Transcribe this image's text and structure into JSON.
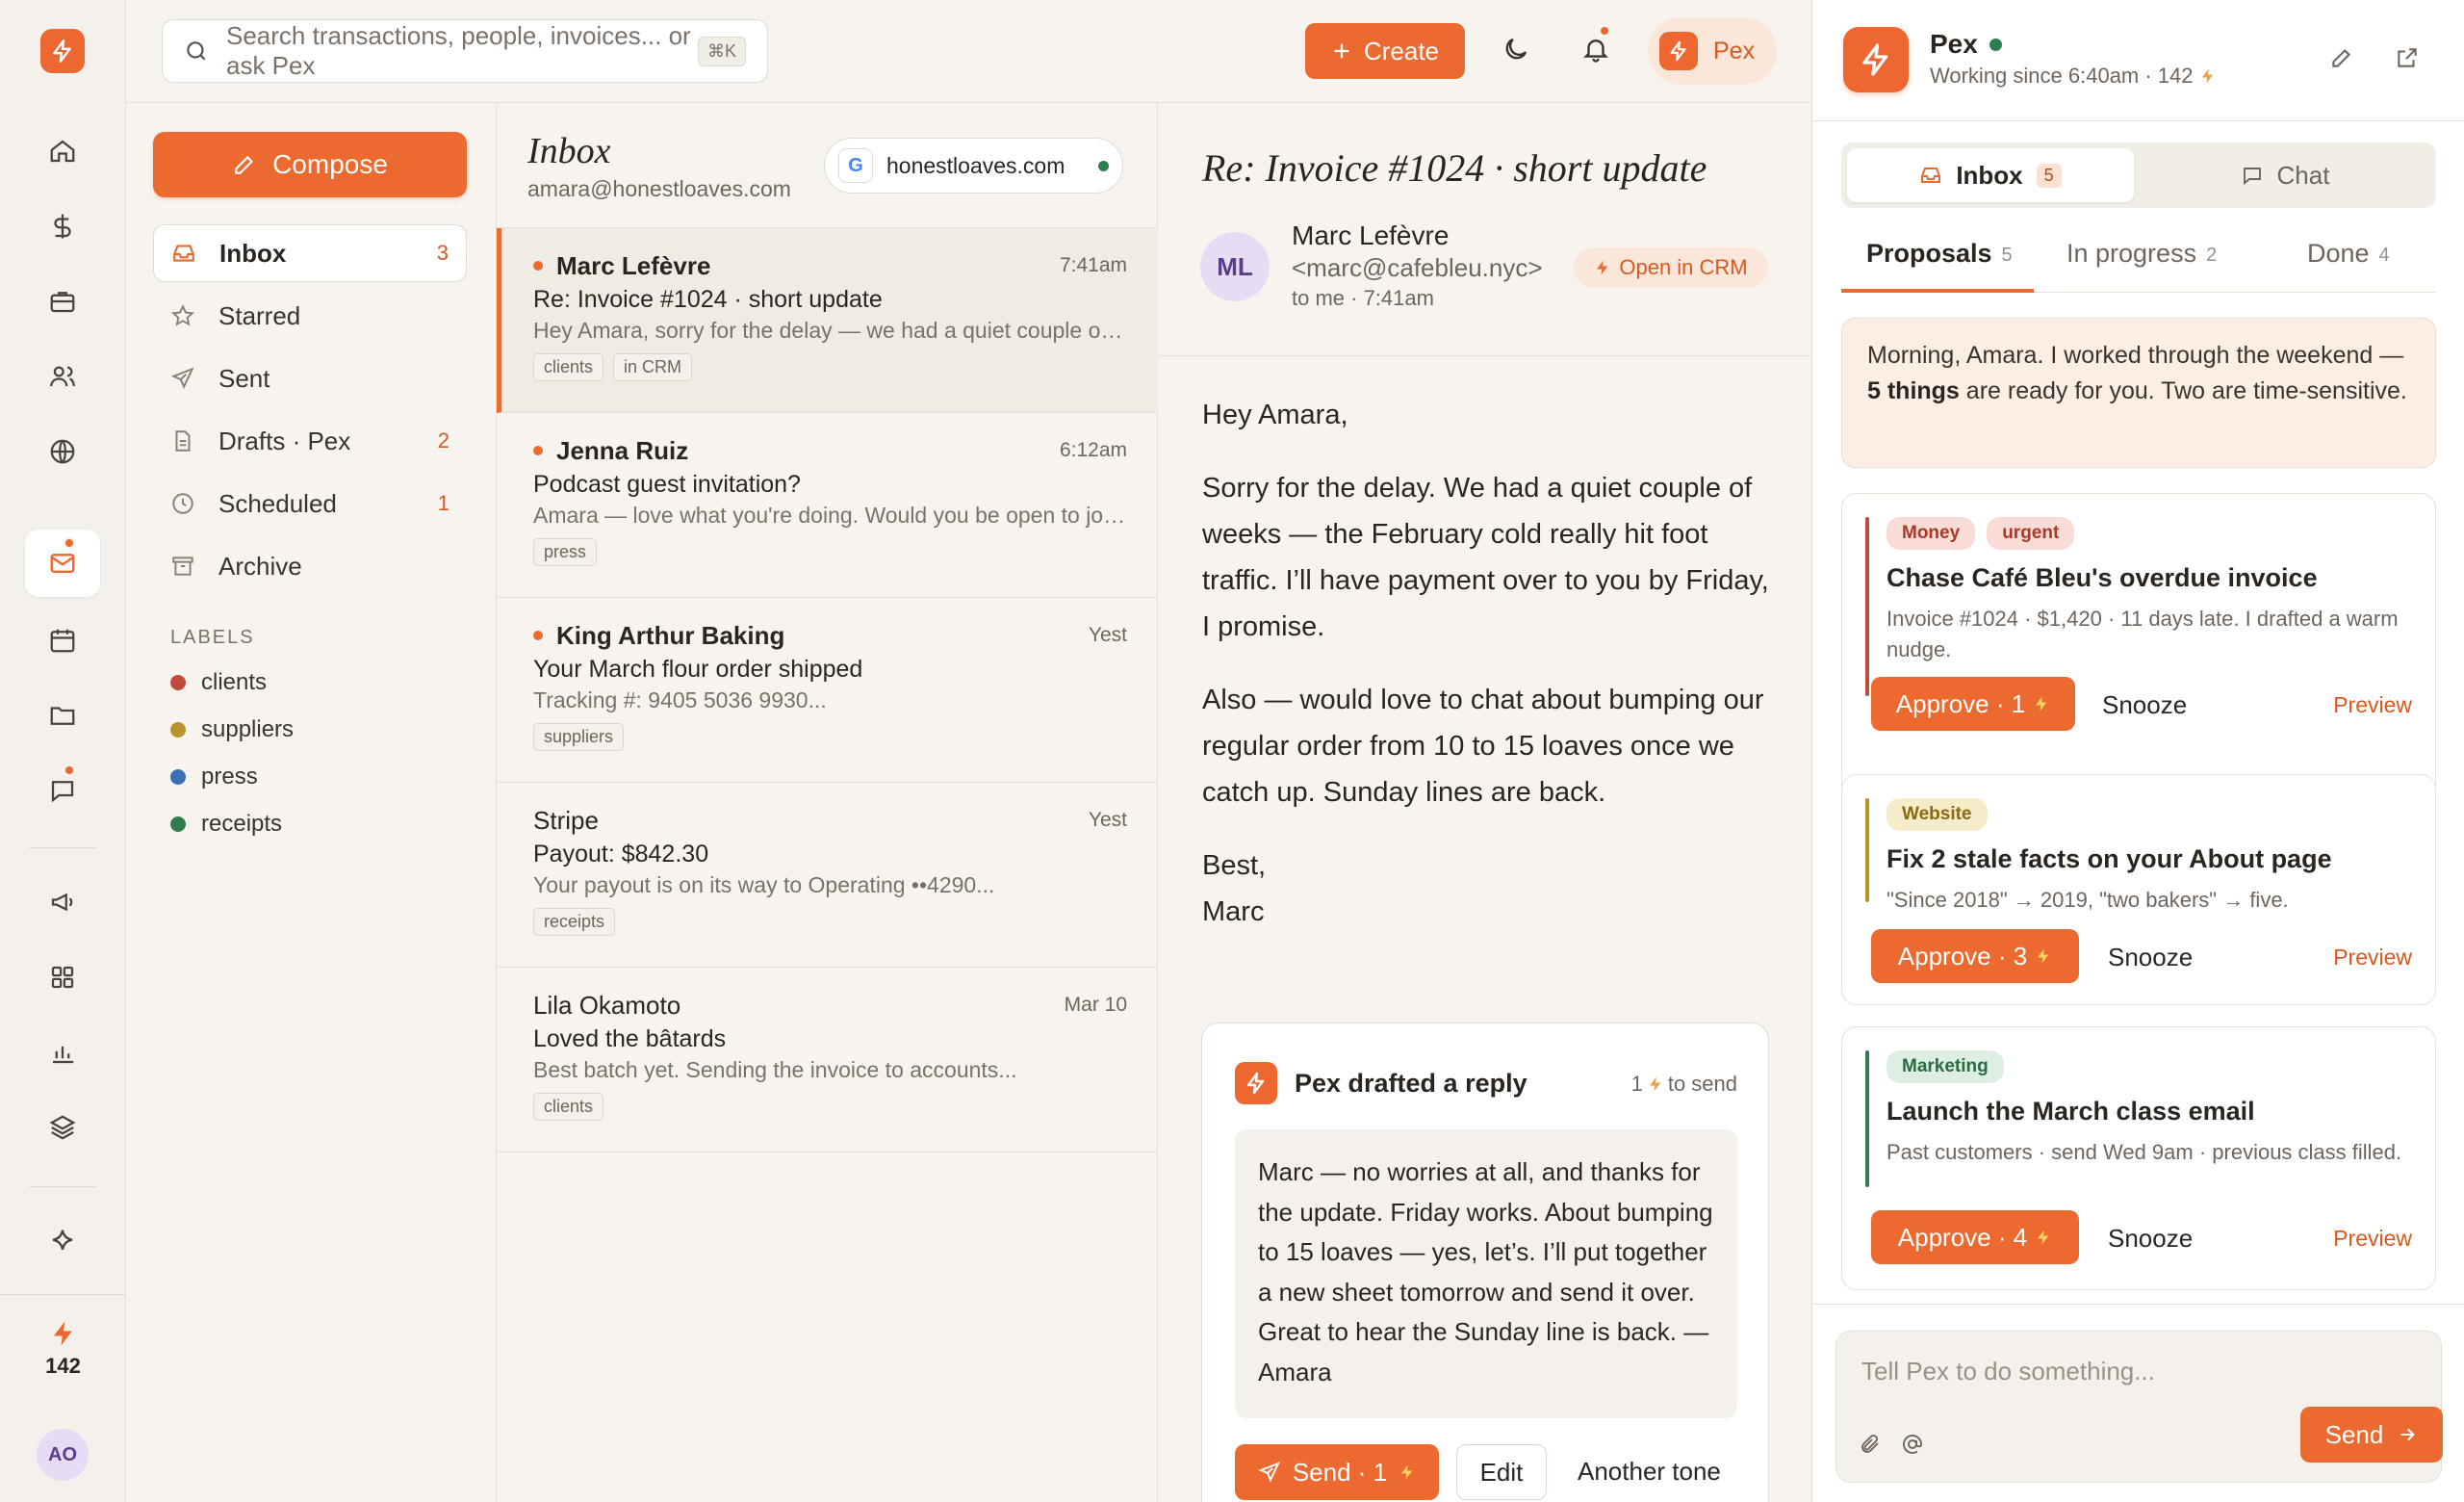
{
  "colors": {
    "accent": "#ec6a2f",
    "online": "#2e7d4f"
  },
  "rail": {
    "credits": "142",
    "avatar_initials": "AO",
    "icons": [
      "home-icon",
      "dollar-icon",
      "briefcase-icon",
      "people-icon",
      "globe-icon",
      "mail-icon",
      "calendar-icon",
      "folder-icon",
      "chat-icon",
      "megaphone-icon",
      "grid-icon",
      "chart-icon",
      "layers-icon",
      "sparkle-icon"
    ]
  },
  "topbar": {
    "search_placeholder": "Search transactions, people, invoices... or ask Pex",
    "search_shortcut": "⌘K",
    "create_label": "Create",
    "pex_label": "Pex"
  },
  "sidebar": {
    "compose_label": "Compose",
    "folders": [
      {
        "label": "Inbox",
        "count": "3"
      },
      {
        "label": "Starred",
        "count": ""
      },
      {
        "label": "Sent",
        "count": ""
      },
      {
        "label": "Drafts · Pex",
        "count": "2"
      },
      {
        "label": "Scheduled",
        "count": "1"
      },
      {
        "label": "Archive",
        "count": ""
      }
    ],
    "labels_title": "LABELS",
    "labels": [
      {
        "name": "clients",
        "color": "#c24a3b"
      },
      {
        "name": "suppliers",
        "color": "#b8922a"
      },
      {
        "name": "press",
        "color": "#3b6fb6"
      },
      {
        "name": "receipts",
        "color": "#2e7d4f"
      }
    ]
  },
  "list": {
    "title": "Inbox",
    "account": "amara@honestloaves.com",
    "domain_chip": {
      "letter": "G",
      "domain": "honestloaves.com"
    },
    "messages": [
      {
        "from": "Marc Lefèvre",
        "time": "7:41am",
        "subject": "Re: Invoice #1024 · short update",
        "preview": "Hey Amara, sorry for the delay — we had a quiet couple of weeks",
        "tags": [
          "clients",
          "in CRM"
        ]
      },
      {
        "from": "Jenna Ruiz",
        "time": "6:12am",
        "subject": "Podcast guest invitation?",
        "preview": "Amara — love what you're doing. Would you be open to joining",
        "tags": [
          "press"
        ]
      },
      {
        "from": "King Arthur Baking",
        "time": "Yest",
        "subject": "Your March flour order shipped",
        "preview": "Tracking #: 9405 5036 9930...",
        "tags": [
          "suppliers"
        ]
      },
      {
        "from": "Stripe",
        "time": "Yest",
        "subject": "Payout: $842.30",
        "preview": "Your payout is on its way to Operating ••4290...",
        "tags": [
          "receipts"
        ]
      },
      {
        "from": "Lila Okamoto",
        "time": "Mar 10",
        "subject": "Loved the bâtards",
        "preview": "Best batch yet. Sending the invoice to accounts...",
        "tags": [
          "clients"
        ]
      }
    ]
  },
  "reader": {
    "title": "Re: Invoice #1024 · short update",
    "avatar_initials": "ML",
    "sender_name": "Marc Lefèvre",
    "sender_email": "<marc@cafebleu.nyc>",
    "to_line": "to me · 7:41am",
    "crm_label": "Open in CRM",
    "body": [
      "Hey Amara,",
      "Sorry for the delay. We had a quiet couple of weeks — the February cold really hit foot traffic. I’ll have payment over to you by Friday, I promise.",
      "Also — would love to chat about bumping our regular order from 10 to 15 loaves once we catch up. Sunday lines are back.",
      "Best,",
      "Marc"
    ],
    "draft": {
      "title": "Pex drafted a reply",
      "cost_num": "1",
      "cost_text": "to send",
      "text": "Marc — no worries at all, and thanks for the update. Friday works. About bumping to 15 loaves — yes, let’s. I’ll put together a new sheet tomorrow and send it over. Great to hear the Sunday line is back. — Amara",
      "send_label": "Send · 1",
      "edit_label": "Edit",
      "tone_label": "Another tone"
    }
  },
  "pex": {
    "name": "Pex",
    "status": "Working since 6:40am · 142",
    "segments": [
      {
        "label": "Inbox",
        "badge": "5"
      },
      {
        "label": "Chat",
        "badge": ""
      }
    ],
    "tabs": [
      {
        "label": "Proposals",
        "count": "5"
      },
      {
        "label": "In progress",
        "count": "2"
      },
      {
        "label": "Done",
        "count": "4"
      }
    ],
    "morning": {
      "pre": "Morning, Amara. I worked through the weekend — ",
      "bold": "5 things",
      "post": " are ready for you. Two are time-sensitive."
    },
    "cards": [
      {
        "tags": [
          "Money",
          "urgent"
        ],
        "title": "Chase Café Bleu's overdue invoice",
        "desc": "Invoice #1024 · $1,420 · 11 days late. I drafted a warm nudge.",
        "approve": "Approve · 1",
        "snooze": "Snooze",
        "preview": "Preview",
        "bar_color": "#c24a3b"
      },
      {
        "tags": [
          "Website"
        ],
        "title": "Fix 2 stale facts on your About page",
        "desc": "\"Since 2018\" → 2019, \"two bakers\" → five.",
        "approve": "Approve · 3",
        "snooze": "Snooze",
        "preview": "Preview",
        "bar_color": "#b8922a"
      },
      {
        "tags": [
          "Marketing"
        ],
        "title": "Launch the March class email",
        "desc": "Past customers · send Wed 9am · previous class filled.",
        "approve": "Approve · 4",
        "snooze": "Snooze",
        "preview": "Preview",
        "bar_color": "#2e7d4f"
      }
    ],
    "composer_placeholder": "Tell Pex to do something...",
    "send_label": "Send"
  }
}
